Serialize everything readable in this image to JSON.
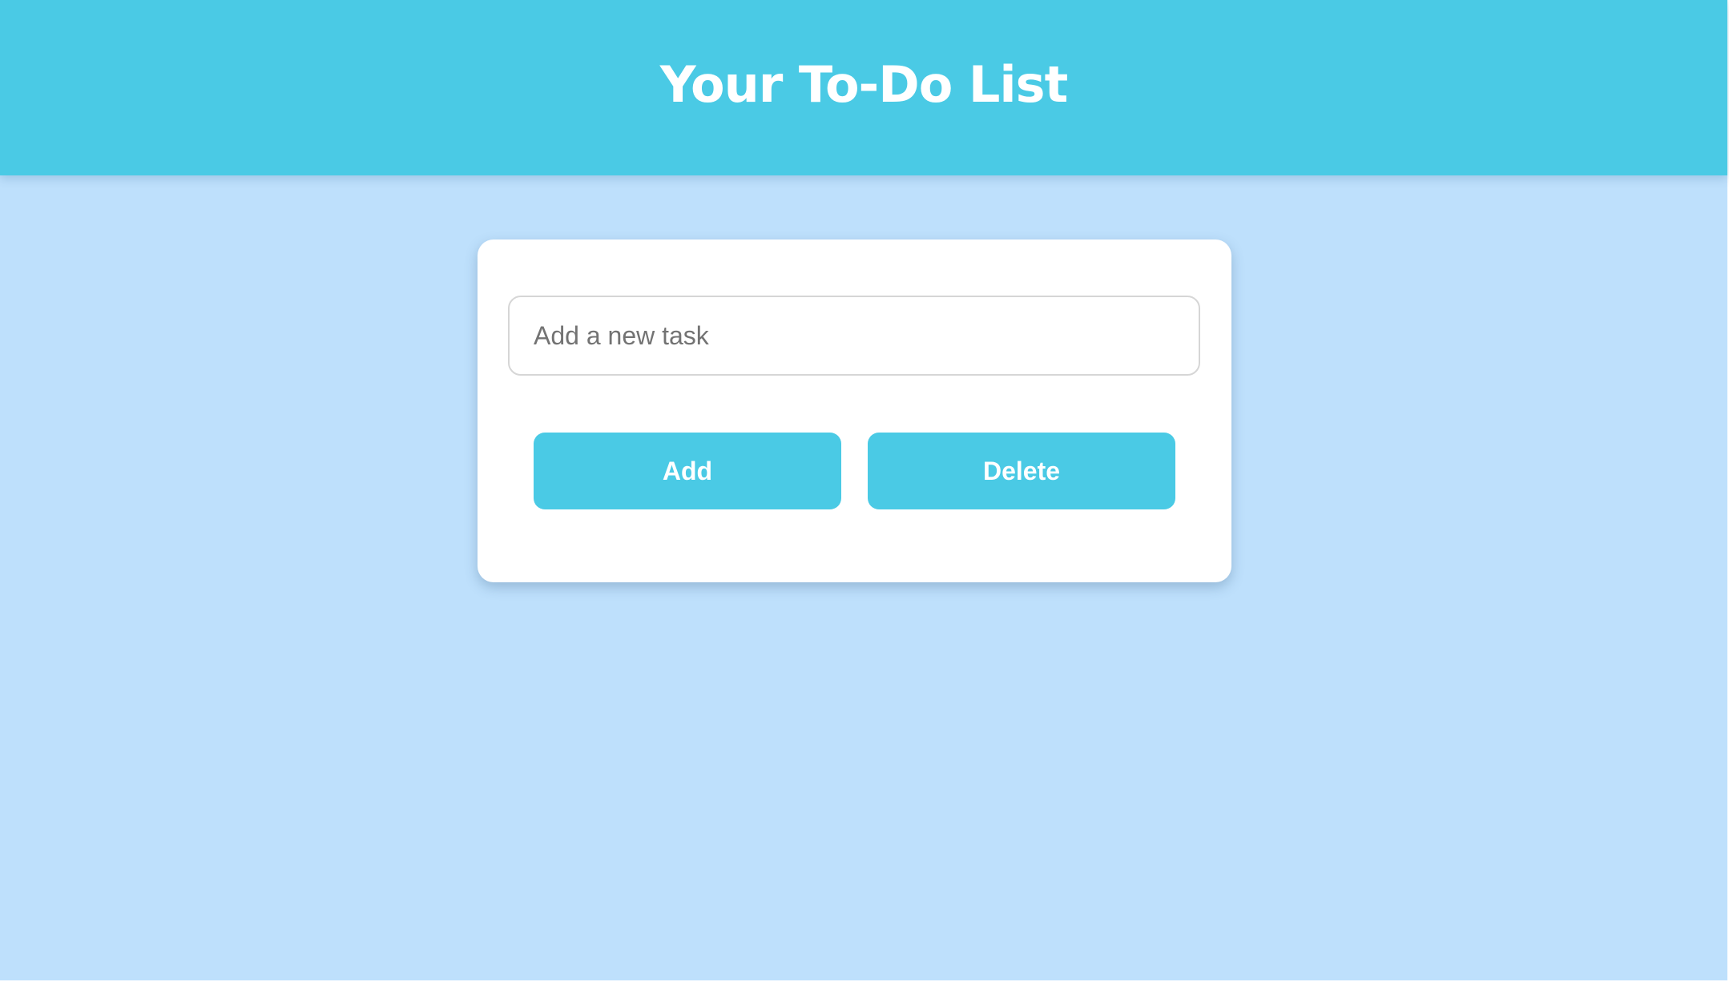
{
  "header": {
    "title": "Your To-Do List"
  },
  "task_form": {
    "input_placeholder": "Add a new task",
    "input_value": "",
    "add_label": "Add",
    "delete_label": "Delete"
  },
  "colors": {
    "accent": "#4acae5",
    "page_background": "#bee0fc",
    "card_background": "#ffffff",
    "button_text": "#ffffff"
  }
}
